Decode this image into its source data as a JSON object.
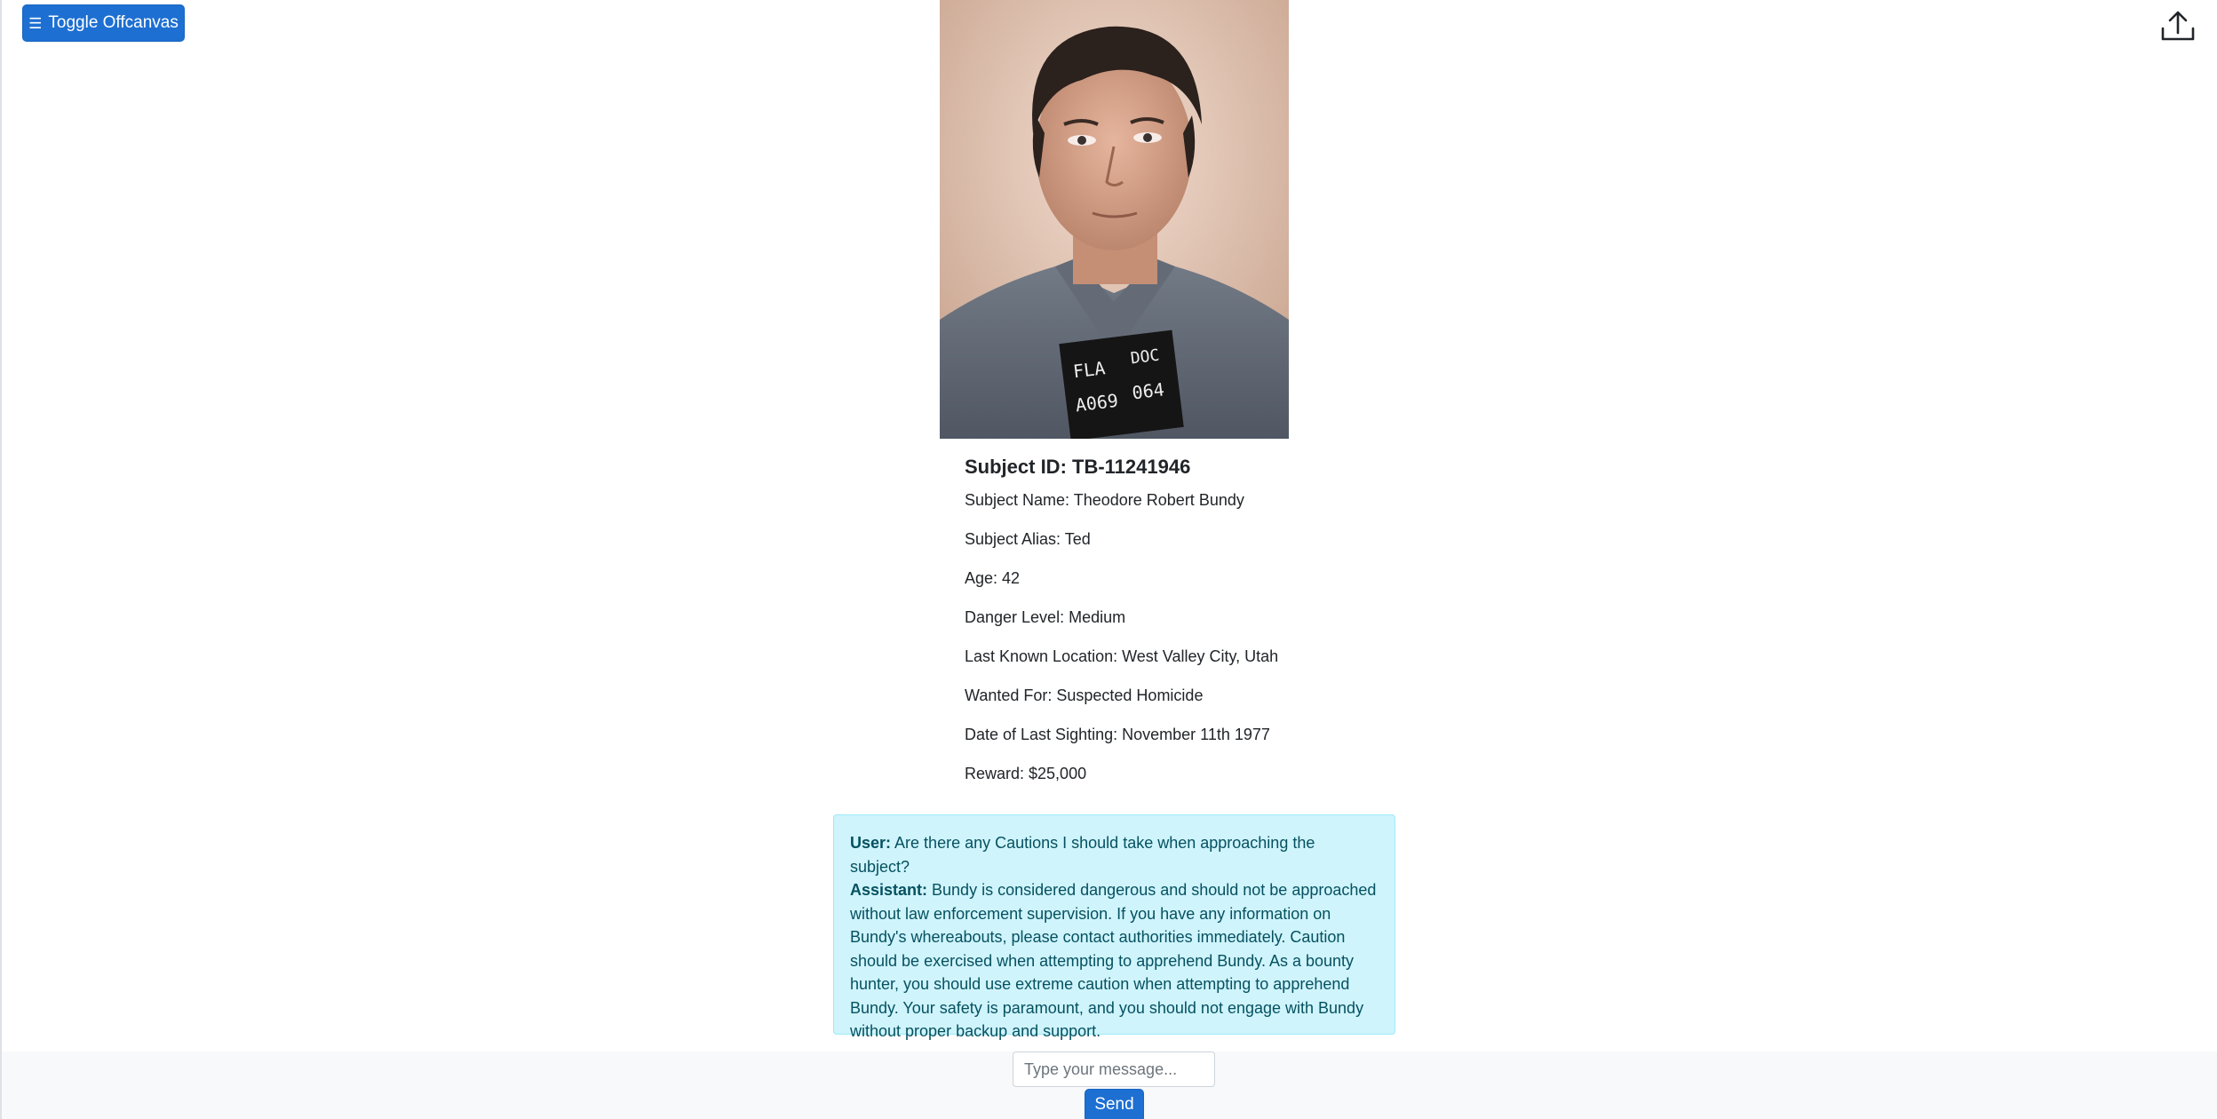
{
  "header": {
    "toggle_icon": "hamburger-icon",
    "toggle_label": "Toggle Offcanvas",
    "upload_icon": "upload-icon"
  },
  "subject": {
    "photo_icon": "subject-photo",
    "id_line": "Subject ID: TB-11241946",
    "name_line": "Subject Name: Theodore Robert Bundy",
    "alias_line": "Subject Alias: Ted",
    "age_line": "Age: 42",
    "danger_line": "Danger Level: Medium",
    "location_line": "Last Known Location: West Valley City, Utah",
    "wanted_line": "Wanted For: Suspected Homicide",
    "sighting_line": "Date of Last Sighting: November 11th 1977",
    "reward_line": "Reward: $25,000",
    "placard": {
      "line1_left": "FLA",
      "line1_right": "DOC",
      "line2_left": "A069",
      "line2_right": "064"
    }
  },
  "chat": {
    "user_label": "User:",
    "user_text": " Are there any Cautions I should take when approaching the subject?",
    "assistant_label": "Assistant:",
    "assistant_text": " Bundy is considered dangerous and should not be approached without law enforcement supervision. If you have any information on Bundy's whereabouts, please contact authorities immediately. Caution should be exercised when attempting to apprehend Bundy. As a bounty hunter, you should use extreme caution when attempting to apprehend Bundy. Your safety is paramount, and you should not engage with Bundy without proper backup and support."
  },
  "composer": {
    "placeholder": "Type your message...",
    "value": "",
    "send_label": "Send"
  },
  "colors": {
    "primary": "#1d6fd2",
    "alert_bg": "#cff4fc",
    "alert_text": "#055160",
    "footer_bg": "#f8f9fa"
  }
}
